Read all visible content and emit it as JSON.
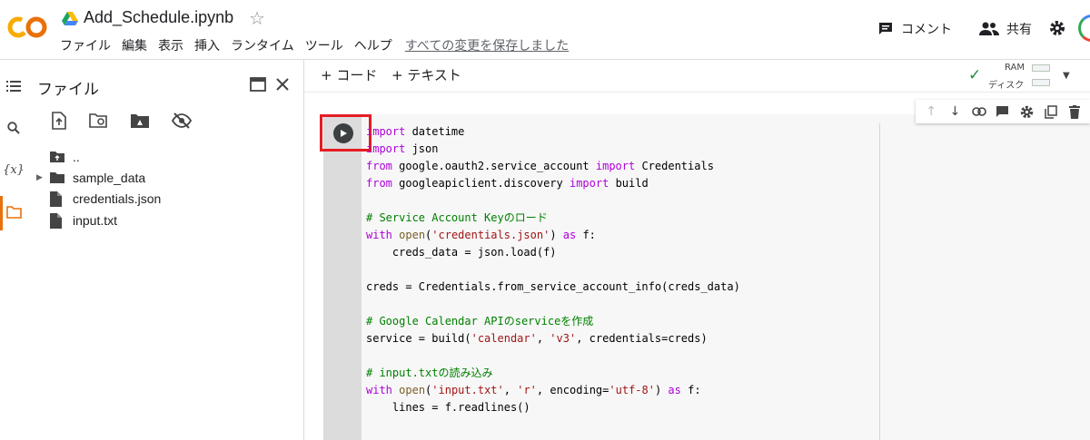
{
  "app": {
    "logo_text": "CO",
    "notebook_title": "Add_Schedule.ipynb",
    "menu": [
      "ファイル",
      "編集",
      "表示",
      "挿入",
      "ランタイム",
      "ツール",
      "ヘルプ"
    ],
    "save_status": "すべての変更を保存しました",
    "comment_label": "コメント",
    "share_label": "共有"
  },
  "sidebar": {
    "rail_icons": [
      "menu-icon",
      "search-icon",
      "variables-icon",
      "folder-icon"
    ],
    "variables_glyph": "{x}",
    "panel_title": "ファイル",
    "tree": [
      {
        "name": "..",
        "type": "parent-folder"
      },
      {
        "name": "sample_data",
        "type": "folder"
      },
      {
        "name": "credentials.json",
        "type": "file"
      },
      {
        "name": "input.txt",
        "type": "file"
      }
    ]
  },
  "notebook": {
    "add_code_label": "+ コード",
    "add_text_label": "+ テキスト",
    "resources": {
      "ram_label": "RAM",
      "disk_label": "ディスク"
    }
  },
  "cell": {
    "lines": [
      {
        "segs": [
          {
            "t": "import",
            "c": "kw"
          },
          {
            "t": " datetime",
            "c": ""
          }
        ]
      },
      {
        "segs": [
          {
            "t": "import",
            "c": "kw"
          },
          {
            "t": " json",
            "c": ""
          }
        ]
      },
      {
        "segs": [
          {
            "t": "from",
            "c": "kw"
          },
          {
            "t": " google.oauth2.service_account ",
            "c": ""
          },
          {
            "t": "import",
            "c": "kw"
          },
          {
            "t": " Credentials",
            "c": ""
          }
        ]
      },
      {
        "segs": [
          {
            "t": "from",
            "c": "kw"
          },
          {
            "t": " googleapiclient.discovery ",
            "c": ""
          },
          {
            "t": "import",
            "c": "kw"
          },
          {
            "t": " build",
            "c": ""
          }
        ]
      },
      {
        "segs": []
      },
      {
        "segs": [
          {
            "t": "# Service Account Keyのロード",
            "c": "cm"
          }
        ]
      },
      {
        "segs": [
          {
            "t": "with",
            "c": "kw"
          },
          {
            "t": " ",
            "c": ""
          },
          {
            "t": "open",
            "c": "fn"
          },
          {
            "t": "(",
            "c": ""
          },
          {
            "t": "'credentials.json'",
            "c": "str"
          },
          {
            "t": ") ",
            "c": ""
          },
          {
            "t": "as",
            "c": "kw"
          },
          {
            "t": " f:",
            "c": ""
          }
        ]
      },
      {
        "segs": [
          {
            "t": "    creds_data = json.load(f)",
            "c": ""
          }
        ]
      },
      {
        "segs": []
      },
      {
        "segs": [
          {
            "t": "creds = Credentials.from_service_account_info(creds_data)",
            "c": ""
          }
        ]
      },
      {
        "segs": []
      },
      {
        "segs": [
          {
            "t": "# Google Calendar APIのserviceを作成",
            "c": "cm"
          }
        ]
      },
      {
        "segs": [
          {
            "t": "service = build(",
            "c": ""
          },
          {
            "t": "'calendar'",
            "c": "str"
          },
          {
            "t": ", ",
            "c": ""
          },
          {
            "t": "'v3'",
            "c": "str"
          },
          {
            "t": ", credentials=creds)",
            "c": ""
          }
        ]
      },
      {
        "segs": []
      },
      {
        "segs": [
          {
            "t": "# input.txtの読み込み",
            "c": "cm"
          }
        ]
      },
      {
        "segs": [
          {
            "t": "with",
            "c": "kw"
          },
          {
            "t": " ",
            "c": ""
          },
          {
            "t": "open",
            "c": "fn"
          },
          {
            "t": "(",
            "c": ""
          },
          {
            "t": "'input.txt'",
            "c": "str"
          },
          {
            "t": ", ",
            "c": ""
          },
          {
            "t": "'r'",
            "c": "str"
          },
          {
            "t": ", encoding=",
            "c": ""
          },
          {
            "t": "'utf-8'",
            "c": "str"
          },
          {
            "t": ") ",
            "c": ""
          },
          {
            "t": "as",
            "c": "kw"
          },
          {
            "t": " f:",
            "c": ""
          }
        ]
      },
      {
        "segs": [
          {
            "t": "    lines = f.readlines()",
            "c": ""
          }
        ]
      }
    ]
  },
  "colors": {
    "logo_orange": "#f9ab00",
    "logo_dark_orange": "#e8710a",
    "keyword": "#af00db",
    "string": "#a31515",
    "comment": "#008000",
    "run_highlight": "#e51c23"
  }
}
